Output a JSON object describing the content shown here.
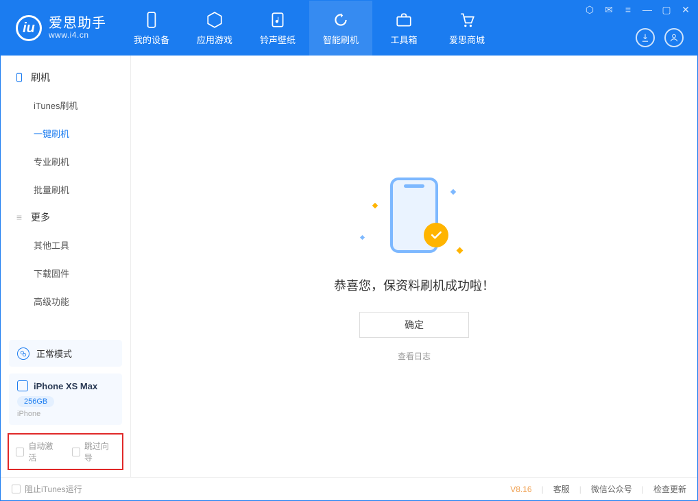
{
  "app": {
    "name": "爱思助手",
    "site": "www.i4.cn"
  },
  "nav": {
    "items": [
      {
        "label": "我的设备",
        "icon": "device"
      },
      {
        "label": "应用游戏",
        "icon": "cube"
      },
      {
        "label": "铃声壁纸",
        "icon": "music"
      },
      {
        "label": "智能刷机",
        "icon": "refresh"
      },
      {
        "label": "工具箱",
        "icon": "toolbox"
      },
      {
        "label": "爱思商城",
        "icon": "cart"
      }
    ],
    "active_index": 3
  },
  "sidebar": {
    "sections": [
      {
        "title": "刷机",
        "icon": "phone-icon",
        "items": [
          {
            "label": "iTunes刷机"
          },
          {
            "label": "一键刷机",
            "active": true
          },
          {
            "label": "专业刷机"
          },
          {
            "label": "批量刷机"
          }
        ]
      },
      {
        "title": "更多",
        "icon": "list-icon",
        "items": [
          {
            "label": "其他工具"
          },
          {
            "label": "下载固件"
          },
          {
            "label": "高级功能"
          }
        ]
      }
    ],
    "status": {
      "label": "正常模式"
    },
    "device": {
      "name": "iPhone XS Max",
      "storage": "256GB",
      "type": "iPhone"
    },
    "options": {
      "auto_activate": "自动激活",
      "skip_guide": "跳过向导"
    }
  },
  "main": {
    "success_message": "恭喜您，保资料刷机成功啦！",
    "ok_label": "确定",
    "view_log": "查看日志"
  },
  "footer": {
    "block_itunes": "阻止iTunes运行",
    "version": "V8.16",
    "links": {
      "support": "客服",
      "wechat": "微信公众号",
      "update": "检查更新"
    }
  }
}
